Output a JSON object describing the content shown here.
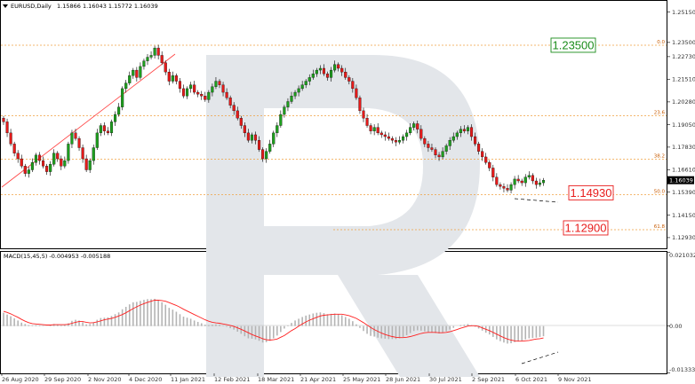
{
  "header": {
    "symbol": "EURUSD,Daily",
    "ohlc": "1.15866 1.16043 1.15772 1.16039"
  },
  "colors": {
    "bull": "#1d9e1d",
    "bear": "#e51a1a",
    "fib": "#f0a040",
    "trend": "#ff4040",
    "macd_hist": "#b4b4b4",
    "macd_signal": "#ff2020",
    "label_green": "#1a8c1a",
    "label_red": "#e81c1c"
  },
  "chart_data": [
    {
      "type": "candlestick",
      "title": "EURUSD,Daily",
      "y_ticks": [
        "1.25150",
        "1.23500",
        "1.22730",
        "1.21510",
        "1.20280",
        "1.19050",
        "1.17830",
        "1.16610",
        "1.15390",
        "1.14150",
        "1.12930"
      ],
      "x_ticks": [
        "26 Aug 2020",
        "29 Sep 2020",
        "2 Nov 2020",
        "4 Dec 2020",
        "11 Jan 2021",
        "12 Feb 2021",
        "18 Mar 2021",
        "21 Apr 2021",
        "25 May 2021",
        "28 Jun 2021",
        "30 Jul 2021",
        "2 Sep 2021",
        "6 Oct 2021",
        "9 Nov 2021"
      ],
      "ylim": [
        1.1235,
        1.2575
      ],
      "last_price": "1.16039",
      "fib_levels": [
        {
          "label": "0.0",
          "value": 1.2335
        },
        {
          "label": "23.6",
          "value": 1.1953
        },
        {
          "label": "38.2",
          "value": 1.1717
        },
        {
          "label": "50.0",
          "value": 1.1526
        },
        {
          "label": "61.8",
          "value": 1.1336
        }
      ],
      "price_labels": [
        {
          "text": "1.23500",
          "value": 1.2335,
          "color": "green"
        },
        {
          "text": "1.14930",
          "value": 1.1526,
          "color": "red"
        },
        {
          "text": "1.12900",
          "value": 1.1336,
          "color": "red"
        }
      ],
      "closes": [
        1.192,
        1.186,
        1.18,
        1.175,
        1.172,
        1.168,
        1.164,
        1.166,
        1.17,
        1.174,
        1.171,
        1.168,
        1.165,
        1.169,
        1.175,
        1.172,
        1.168,
        1.171,
        1.18,
        1.186,
        1.183,
        1.178,
        1.172,
        1.166,
        1.171,
        1.178,
        1.186,
        1.19,
        1.187,
        1.186,
        1.192,
        1.196,
        1.2,
        1.21,
        1.213,
        1.217,
        1.22,
        1.216,
        1.222,
        1.225,
        1.227,
        1.228,
        1.232,
        1.228,
        1.224,
        1.219,
        1.214,
        1.217,
        1.214,
        1.21,
        1.206,
        1.21,
        1.212,
        1.208,
        1.207,
        1.206,
        1.204,
        1.208,
        1.211,
        1.214,
        1.212,
        1.208,
        1.205,
        1.201,
        1.198,
        1.194,
        1.19,
        1.186,
        1.182,
        1.185,
        1.182,
        1.177,
        1.172,
        1.176,
        1.18,
        1.186,
        1.19,
        1.196,
        1.2,
        1.203,
        1.206,
        1.208,
        1.21,
        1.212,
        1.214,
        1.216,
        1.218,
        1.22,
        1.221,
        1.218,
        1.216,
        1.22,
        1.223,
        1.221,
        1.219,
        1.216,
        1.214,
        1.21,
        1.205,
        1.198,
        1.194,
        1.19,
        1.187,
        1.189,
        1.186,
        1.185,
        1.184,
        1.183,
        1.182,
        1.181,
        1.182,
        1.184,
        1.186,
        1.189,
        1.191,
        1.188,
        1.183,
        1.18,
        1.178,
        1.177,
        1.174,
        1.173,
        1.176,
        1.179,
        1.182,
        1.184,
        1.186,
        1.188,
        1.187,
        1.189,
        1.184,
        1.18,
        1.176,
        1.173,
        1.17,
        1.167,
        1.162,
        1.158,
        1.157,
        1.156,
        1.155,
        1.158,
        1.161,
        1.16,
        1.159,
        1.162,
        1.163,
        1.16,
        1.158,
        1.159,
        1.16039
      ],
      "macd_hist": [
        0.0038,
        0.0033,
        0.0028,
        0.0022,
        0.0016,
        0.001,
        0.0006,
        0.0003,
        0.0002,
        0.0003,
        0.0002,
        0.0001,
        0.0,
        0.0002,
        0.0006,
        0.0005,
        0.0002,
        0.0003,
        0.0008,
        0.0015,
        0.0018,
        0.0016,
        0.0011,
        0.0005,
        0.0006,
        0.0011,
        0.0018,
        0.0023,
        0.0024,
        0.0025,
        0.0029,
        0.0034,
        0.0039,
        0.0048,
        0.0055,
        0.0062,
        0.0068,
        0.0069,
        0.0072,
        0.0075,
        0.0077,
        0.0077,
        0.0078,
        0.0074,
        0.0068,
        0.0061,
        0.0052,
        0.0047,
        0.0041,
        0.0034,
        0.0027,
        0.0024,
        0.0021,
        0.0016,
        0.0012,
        0.0008,
        0.0004,
        0.0003,
        0.0004,
        0.0005,
        0.0004,
        0.0001,
        -0.0002,
        -0.0006,
        -0.001,
        -0.0016,
        -0.0022,
        -0.0029,
        -0.0035,
        -0.0036,
        -0.0038,
        -0.0042,
        -0.0047,
        -0.0046,
        -0.0042,
        -0.0035,
        -0.0027,
        -0.0017,
        -0.0007,
        0.0002,
        0.0009,
        0.0016,
        0.0021,
        0.0026,
        0.003,
        0.0033,
        0.0036,
        0.0038,
        0.0039,
        0.0037,
        0.0034,
        0.0035,
        0.0036,
        0.0034,
        0.0031,
        0.0026,
        0.0021,
        0.0014,
        0.0005,
        -0.0005,
        -0.0014,
        -0.0022,
        -0.0028,
        -0.003,
        -0.0033,
        -0.0035,
        -0.0036,
        -0.0037,
        -0.0037,
        -0.0037,
        -0.0035,
        -0.0031,
        -0.0026,
        -0.002,
        -0.0014,
        -0.0012,
        -0.0013,
        -0.0015,
        -0.0017,
        -0.0018,
        -0.002,
        -0.0021,
        -0.0019,
        -0.0015,
        -0.001,
        -0.0005,
        0.0,
        0.0003,
        0.0004,
        0.0006,
        0.0003,
        -0.0002,
        -0.0007,
        -0.0013,
        -0.0019,
        -0.0024,
        -0.0031,
        -0.0038,
        -0.0043,
        -0.0047,
        -0.005,
        -0.0049,
        -0.0046,
        -0.0044,
        -0.0042,
        -0.0038,
        -0.0035,
        -0.0034,
        -0.0033,
        -0.0031,
        -0.0029
      ],
      "macd_signal": [
        0.0042,
        0.0039,
        0.0035,
        0.003,
        0.0025,
        0.0019,
        0.0014,
        0.001,
        0.0007,
        0.0006,
        0.0005,
        0.0004,
        0.0003,
        0.0003,
        0.0004,
        0.0004,
        0.0004,
        0.0004,
        0.0005,
        0.0008,
        0.0011,
        0.0013,
        0.0013,
        0.0011,
        0.0009,
        0.001,
        0.0012,
        0.0015,
        0.0018,
        0.002,
        0.0022,
        0.0025,
        0.0029,
        0.0033,
        0.0038,
        0.0044,
        0.005,
        0.0055,
        0.006,
        0.0064,
        0.0068,
        0.0071,
        0.0074,
        0.0074,
        0.0073,
        0.0071,
        0.0067,
        0.0063,
        0.0059,
        0.0054,
        0.0048,
        0.0043,
        0.0038,
        0.0033,
        0.0028,
        0.0023,
        0.0018,
        0.0014,
        0.0011,
        0.0009,
        0.0008,
        0.0006,
        0.0004,
        0.0002,
        -0.0001,
        -0.0005,
        -0.0009,
        -0.0014,
        -0.0019,
        -0.0024,
        -0.0028,
        -0.0032,
        -0.0036,
        -0.0039,
        -0.004,
        -0.0039,
        -0.0037,
        -0.0032,
        -0.0027,
        -0.002,
        -0.0013,
        -0.0007,
        0.0,
        0.0006,
        0.0012,
        0.0017,
        0.0021,
        0.0025,
        0.0029,
        0.0031,
        0.0032,
        0.0033,
        0.0034,
        0.0034,
        0.0034,
        0.0032,
        0.003,
        0.0026,
        0.0022,
        0.0016,
        0.001,
        0.0003,
        -0.0004,
        -0.001,
        -0.0015,
        -0.002,
        -0.0024,
        -0.0027,
        -0.003,
        -0.0032,
        -0.0033,
        -0.0033,
        -0.0032,
        -0.003,
        -0.0027,
        -0.0024,
        -0.0021,
        -0.0019,
        -0.0018,
        -0.0018,
        -0.0018,
        -0.0019,
        -0.0019,
        -0.0018,
        -0.0016,
        -0.0013,
        -0.001,
        -0.0006,
        -0.0003,
        0.0,
        0.0001,
        0.0001,
        -0.0001,
        -0.0005,
        -0.0009,
        -0.0013,
        -0.0018,
        -0.0023,
        -0.0028,
        -0.0033,
        -0.0037,
        -0.004,
        -0.0042,
        -0.0043,
        -0.0043,
        -0.0042,
        -0.0041,
        -0.0039,
        -0.0037,
        -0.0036,
        -0.0034
      ]
    },
    {
      "type": "macd",
      "title": "MACD(15,45,5) -0.004953 -0.005188",
      "label": "MACD(15,45,5)",
      "values_text": "-0.004953 -0.005188",
      "y_ticks": [
        "0.0210323",
        "0.00",
        "-0.0133347"
      ],
      "ylim": [
        -0.0135,
        0.0212
      ]
    }
  ]
}
